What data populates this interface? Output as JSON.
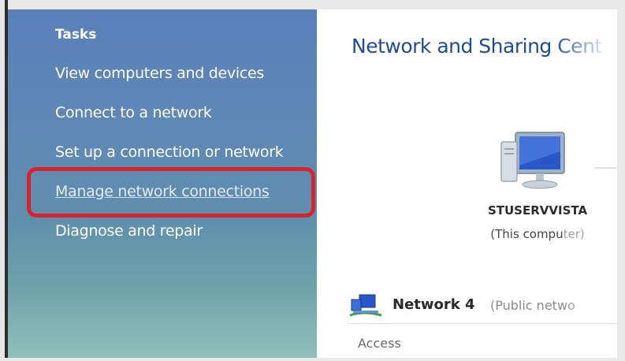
{
  "sidebar": {
    "heading": "Tasks",
    "items": [
      {
        "label": "View computers and devices"
      },
      {
        "label": "Connect to a network"
      },
      {
        "label": "Set up a connection or network"
      },
      {
        "label": "Manage network connections",
        "highlighted": true
      },
      {
        "label": "Diagnose and repair"
      }
    ]
  },
  "main": {
    "title": "Network and Sharing Cent",
    "computer": {
      "name": "STUSERVVISTA",
      "subtitle": "(This compu",
      "subtitle_faded": "ter)"
    },
    "network": {
      "name": "Network  4",
      "type": "(Public netwo"
    },
    "access_label": "Access"
  },
  "colors": {
    "title_blue": "#1e4b9c",
    "highlight_red": "#d8242b",
    "sidebar_top": "#5a80b8",
    "sidebar_bottom": "#8fc1b9"
  }
}
